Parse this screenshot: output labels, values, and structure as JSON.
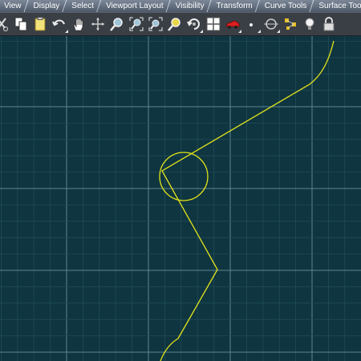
{
  "menu_tabs": [
    {
      "label": "View"
    },
    {
      "label": "Display"
    },
    {
      "label": "Select"
    },
    {
      "label": "Viewport Layout"
    },
    {
      "label": "Visibility"
    },
    {
      "label": "Transform"
    },
    {
      "label": "Curve Tools"
    },
    {
      "label": "Surface Tools"
    }
  ],
  "toolbar": {
    "icons": [
      "cut-icon",
      "copy-icon",
      "paste-icon",
      "undo-icon",
      "pan-hand-icon",
      "rotate-view-icon",
      "zoom-icon",
      "zoom-window-icon",
      "zoom-extents-icon",
      "zoom-selected-icon",
      "rotate-arrow-icon",
      "four-viewports-icon",
      "car-render-icon",
      "point-icon",
      "circle-target-icon",
      "object-snap-icon",
      "light-bulb-icon",
      "lock-icon"
    ]
  },
  "colors": {
    "viewport_bg": "#0f3540",
    "grid_minor": "#1f4d58",
    "grid_major": "#5f8690",
    "curve": "#e6e619"
  }
}
